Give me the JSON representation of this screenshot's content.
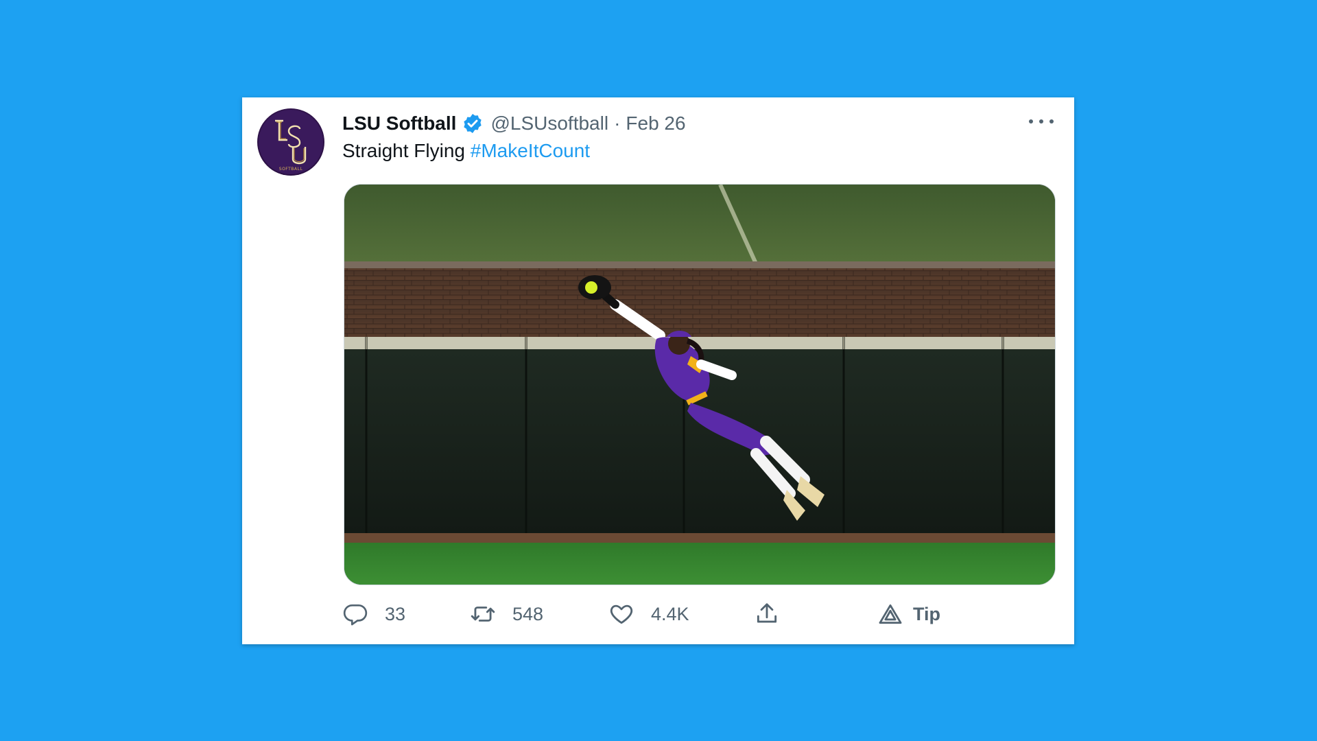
{
  "tweet": {
    "display_name": "LSU Softball",
    "verified": true,
    "handle": "@LSUsoftball",
    "separator": "·",
    "date": "Feb 26",
    "text": "Straight Flying ",
    "hashtag": "#MakeItCount",
    "avatar_text": "SOFTBALL"
  },
  "actions": {
    "replies": "33",
    "retweets": "548",
    "likes": "4.4K",
    "tip_label": "Tip"
  },
  "icons": [
    "verified-badge-icon",
    "more-icon",
    "reply-icon",
    "retweet-icon",
    "like-icon",
    "share-icon",
    "tip-icon"
  ],
  "colors": {
    "background": "#1da1f2",
    "link": "#1d9bf0",
    "secondary_text": "#536471",
    "primary_text": "#0f1419",
    "uniform_purple": "#5a2aa8",
    "uniform_gold": "#f2b21a"
  }
}
